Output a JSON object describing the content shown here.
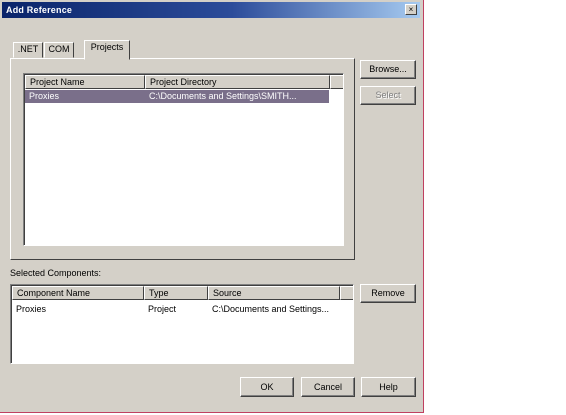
{
  "window": {
    "title": "Add Reference",
    "close_glyph": "×"
  },
  "tabs": [
    {
      "label": ".NET",
      "active": false
    },
    {
      "label": "COM",
      "active": false
    },
    {
      "label": "Projects",
      "active": true
    }
  ],
  "projects_list": {
    "columns": [
      "Project Name",
      "Project Directory"
    ],
    "rows": [
      {
        "name": "Proxies",
        "directory": "C:\\Documents and Settings\\SMITH..."
      }
    ]
  },
  "side_buttons": {
    "browse": "Browse...",
    "select": "Select"
  },
  "selected_components": {
    "label": "Selected Components:",
    "columns": [
      "Component Name",
      "Type",
      "Source"
    ],
    "rows": [
      {
        "name": "Proxies",
        "type": "Project",
        "source": "C:\\Documents and Settings..."
      }
    ],
    "remove_label": "Remove"
  },
  "footer": {
    "ok": "OK",
    "cancel": "Cancel",
    "help": "Help"
  },
  "colors": {
    "titlebar_start": "#0a246a",
    "titlebar_end": "#a6caf0",
    "selection": "#7a6f8a",
    "face": "#d4d0c8"
  }
}
